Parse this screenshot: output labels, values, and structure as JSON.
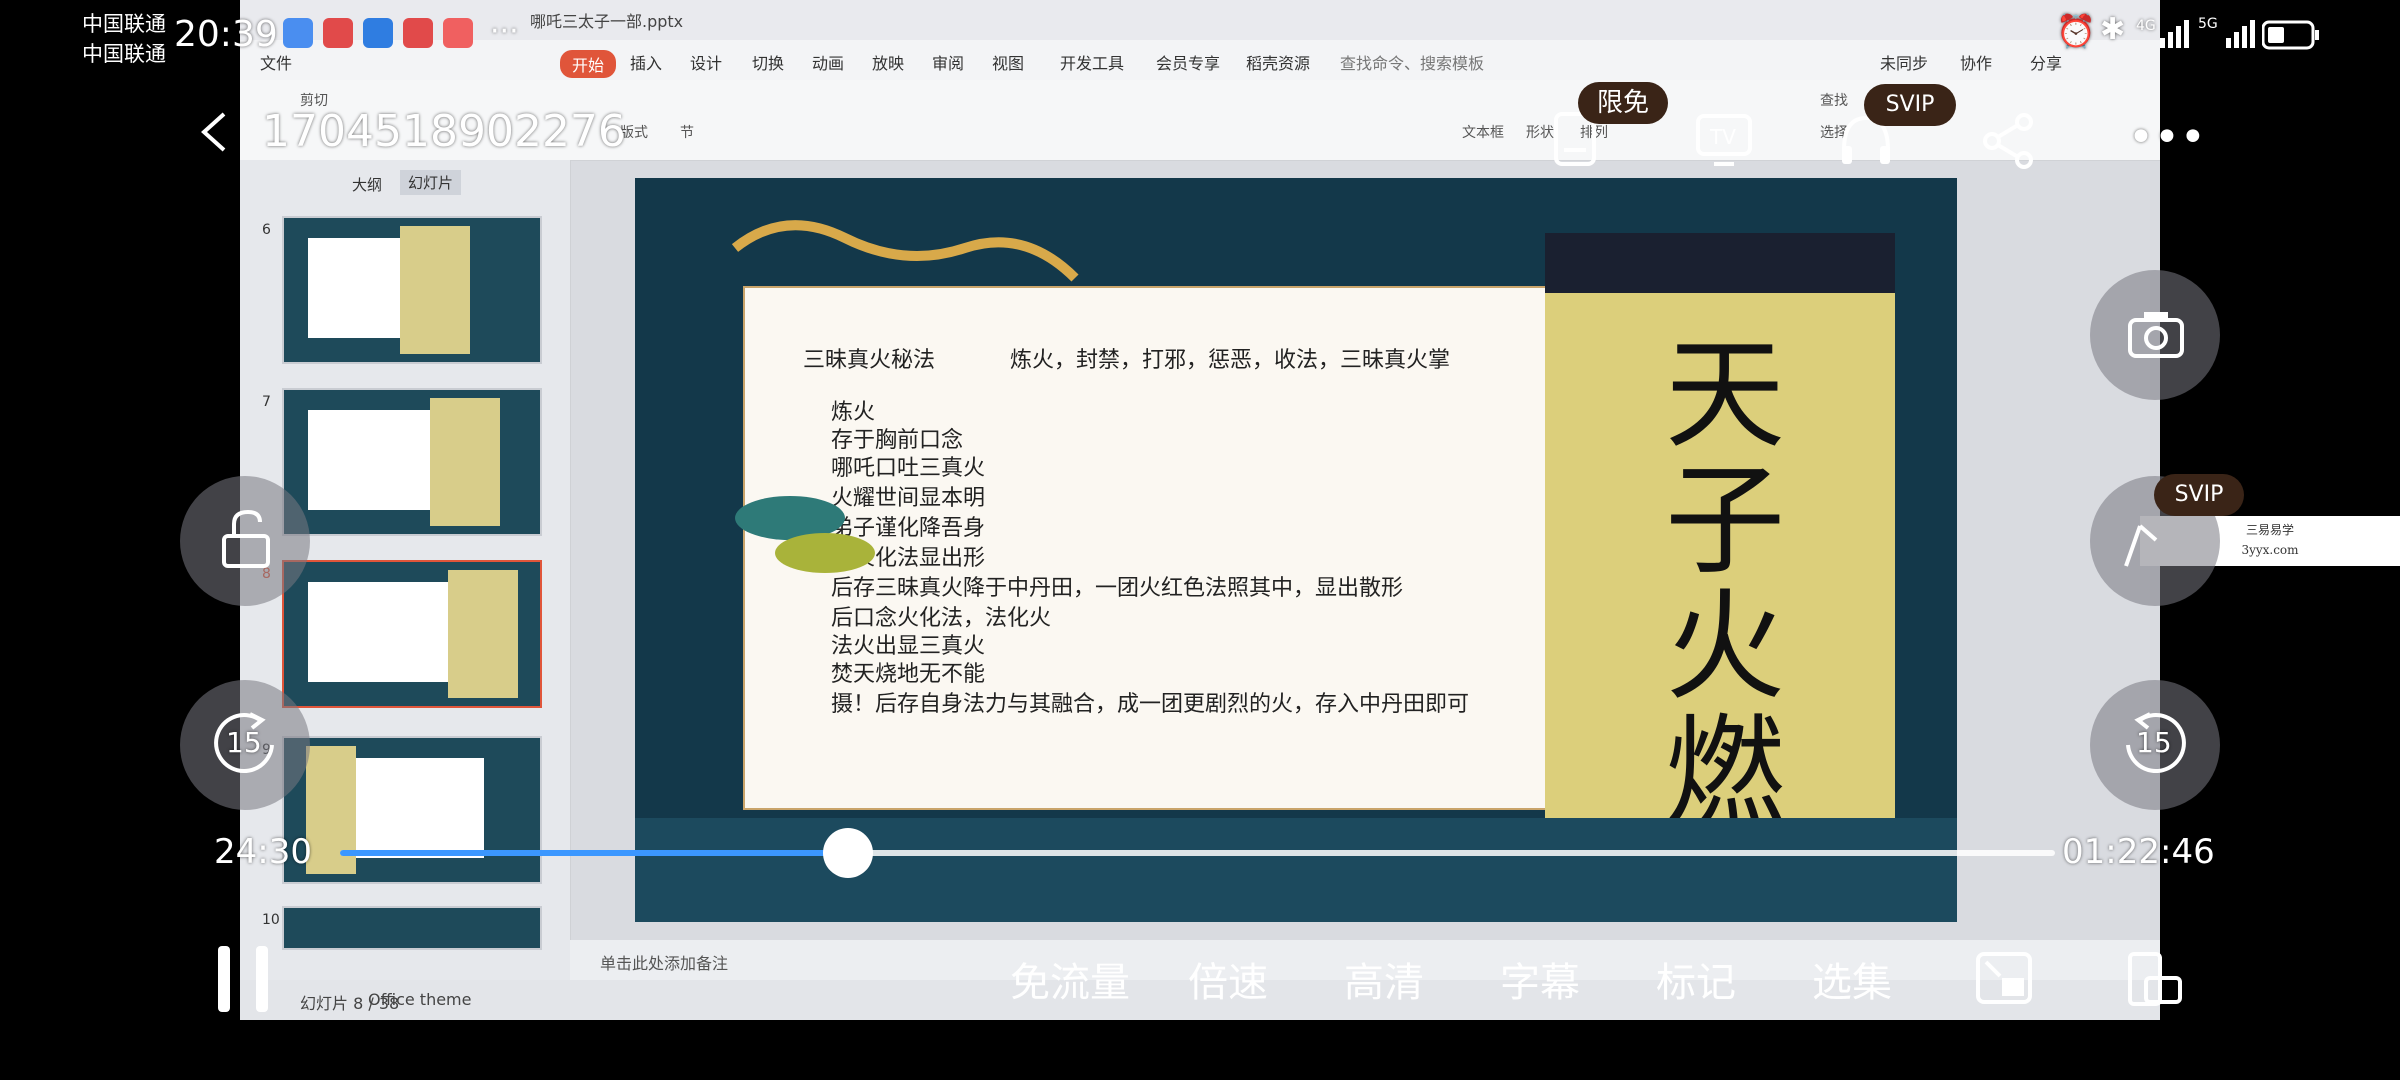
{
  "status_bar": {
    "carrier_1": "中国联通",
    "carrier_2": "中国联通",
    "time": "20:39",
    "network": "5G",
    "network_4g": "4G"
  },
  "player": {
    "title": "1704518902276",
    "badge_free": "限免",
    "badge_svip": "SVIP",
    "elapsed": "24:30",
    "duration": "01:22:46",
    "progress": 0.296,
    "seek_back_seconds": "15",
    "seek_forward_seconds": "15",
    "controls": {
      "free_data": "免流量",
      "speed": "倍速",
      "quality": "高清",
      "subtitles": "字幕",
      "mark": "标记",
      "episodes": "选集"
    }
  },
  "ppt": {
    "file_tab": "哪吒三太子一部.pptx",
    "menu": [
      "文件",
      "开始",
      "插入",
      "设计",
      "切换",
      "动画",
      "放映",
      "审阅",
      "视图",
      "开发工具",
      "会员专享",
      "稻壳资源"
    ],
    "search_placeholder": "查找命令、搜索模板",
    "sync": "未同步",
    "collab": "协作",
    "share": "分享",
    "ribbon": [
      "剪切",
      "版式",
      "节",
      "文本框",
      "形状",
      "排列",
      "查找",
      "选择"
    ],
    "panel_tabs": [
      "大纲",
      "幻灯片"
    ],
    "slide_numbers": [
      "6",
      "7",
      "8",
      "9",
      "10"
    ],
    "notes_placeholder": "单击此处添加备注",
    "status_slide": "幻灯片 8 / 38",
    "status_theme": "Office theme",
    "slide": {
      "heading": "三昧真火秘法",
      "subheading": "炼火，封禁，打邪，惩恶，收法，三昧真火掌",
      "lines": [
        "炼火",
        "存于胸前口念",
        "哪吒口吐三真火",
        "火耀世间显本明",
        "弟子谨化降吾身",
        "真火化法显出形",
        "后存三昧真火降于中丹田，一团火红色法照其中，显出散形",
        "后口念火化法，法化火",
        "法火出显三真火",
        "焚天烧地无不能",
        "摄！后存自身法力与其融合，成一团更剧烈的火，存入中丹田即可"
      ],
      "talisman": "天子火燃"
    }
  },
  "watermark": {
    "line1": "三易易学",
    "line2": "3yyx.com"
  },
  "colors": {
    "accent": "#3b97ff",
    "slide_bg": "#13384a",
    "ppt_tab_active": "#e0553a",
    "svip_bg": "#3a2417"
  }
}
